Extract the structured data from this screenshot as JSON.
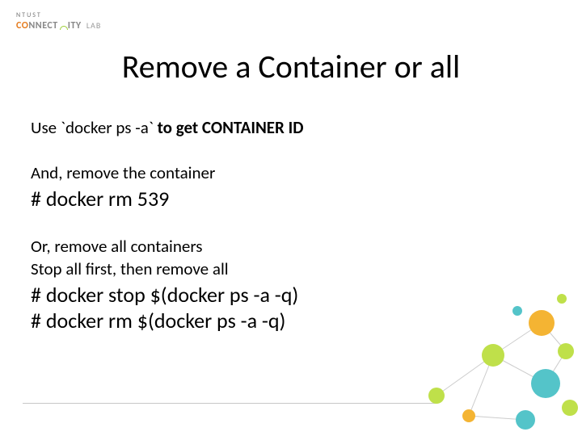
{
  "logo": {
    "ntust": "NTUST",
    "brand_pre": "C",
    "brand_mid1": "O",
    "brand_mid2": "NNECT",
    "brand_mid3": "I",
    "brand_end": "TY",
    "lab": "LAB"
  },
  "title": "Remove a Container or all",
  "body": {
    "l1a": "Use `docker ps -a` ",
    "l1b": "to get CONTAINER ID",
    "l2": "And, remove the container",
    "cmd1": "# docker rm 539",
    "l3": "Or, remove all containers",
    "l4": "Stop all first, then remove all",
    "cmd2": "# docker stop $(docker ps -a -q)",
    "cmd3": "# docker rm $(docker ps -a -q)"
  }
}
